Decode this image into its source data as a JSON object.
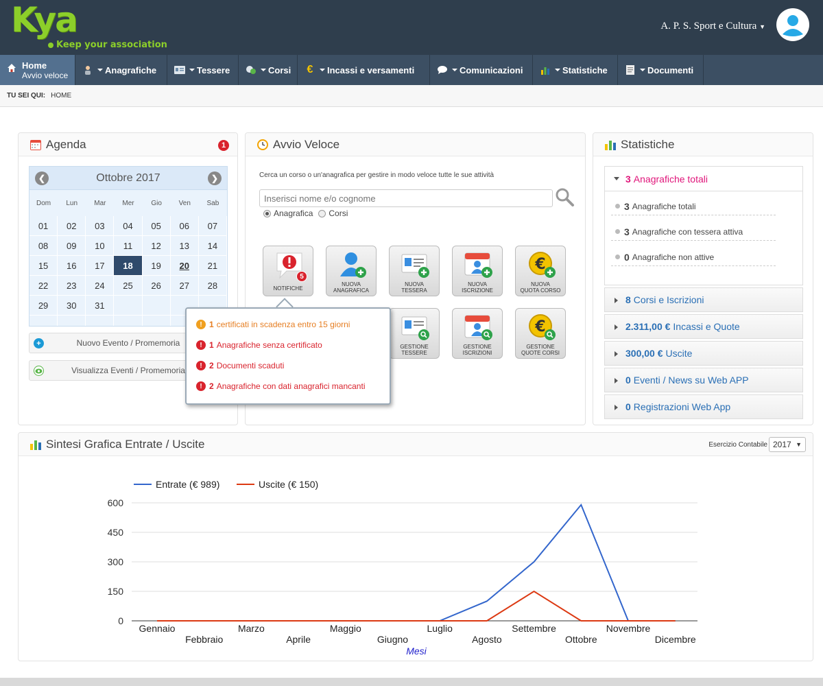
{
  "header": {
    "logo_text": "Kya",
    "logo_tagline": "Keep your association",
    "org_name": "A. P. S. Sport e Cultura",
    "avatar_icon": "user-avatar-icon"
  },
  "menu": {
    "home": {
      "label": "Home",
      "sublabel": "Avvio veloce"
    },
    "items": [
      {
        "label": "Anagrafiche"
      },
      {
        "label": "Tessere"
      },
      {
        "label": "Corsi"
      },
      {
        "label": "Incassi e versamenti"
      },
      {
        "label": "Comunicazioni"
      },
      {
        "label": "Statistiche"
      },
      {
        "label": "Documenti"
      }
    ]
  },
  "breadcrumb": {
    "prefix": "TU SEI QUI:",
    "current": "HOME"
  },
  "agenda": {
    "title": "Agenda",
    "badge": "1",
    "month_label": "Ottobre 2017",
    "weekdays": [
      "Dom",
      "Lun",
      "Mar",
      "Mer",
      "Gio",
      "Ven",
      "Sab"
    ],
    "weeks": [
      [
        "01",
        "02",
        "03",
        "04",
        "05",
        "06",
        "07"
      ],
      [
        "08",
        "09",
        "10",
        "11",
        "12",
        "13",
        "14"
      ],
      [
        "15",
        "16",
        "17",
        "18",
        "19",
        "20",
        "21"
      ],
      [
        "22",
        "23",
        "24",
        "25",
        "26",
        "27",
        "28"
      ],
      [
        "29",
        "30",
        "31",
        "",
        "",
        "",
        ""
      ],
      [
        "",
        "",
        "",
        "",
        "",
        "",
        ""
      ]
    ],
    "today": "18",
    "marked": "20",
    "new_event_label": "Nuovo Evento / Promemoria",
    "view_events_label": "Visualizza Eventi / Promemoria"
  },
  "avvio": {
    "title": "Avvio Veloce",
    "description": "Cerca un corso o un'anagrafica per gestire in modo veloce tutte le sue attività",
    "search_placeholder": "Inserisci nome e/o cognome",
    "radio_anagrafica": "Anagrafica",
    "radio_corsi": "Corsi",
    "tiles_row1": [
      {
        "line1": "NOTIFICHE",
        "line2": ""
      },
      {
        "line1": "NUOVA",
        "line2": "ANAGRAFICA"
      },
      {
        "line1": "NUOVA",
        "line2": "TESSERA"
      },
      {
        "line1": "NUOVA",
        "line2": "ISCRIZIONE"
      },
      {
        "line1": "NUOVA",
        "line2": "QUOTA CORSO"
      }
    ],
    "tiles_row2": [
      {
        "line1": "GESTIONE",
        "line2": "TESSERE"
      },
      {
        "line1": "GESTIONE",
        "line2": "ISCRIZIONI"
      },
      {
        "line1": "GESTIONE",
        "line2": "QUOTE CORSI"
      }
    ],
    "notifications_count": "5",
    "popup": [
      {
        "count": "1",
        "text": "certificati in scadenza entro 15 giorni",
        "level": "warning"
      },
      {
        "count": "1",
        "text": "Anagrafiche senza certificato",
        "level": "error"
      },
      {
        "count": "2",
        "text": "Documenti scaduti",
        "level": "error"
      },
      {
        "count": "2",
        "text": "Anagrafiche con dati anagrafici mancanti",
        "level": "error"
      }
    ]
  },
  "stats": {
    "title": "Statistiche",
    "expanded": {
      "count": "3",
      "label": "Anagrafiche totali"
    },
    "sub": [
      {
        "count": "3",
        "label": "Anagrafiche totali"
      },
      {
        "count": "3",
        "label": "Anagrafiche con tessera attiva"
      },
      {
        "count": "0",
        "label": "Anagrafiche non attive"
      }
    ],
    "rows": [
      {
        "count": "8",
        "label": "Corsi e Iscrizioni"
      },
      {
        "count": "2.311,00 €",
        "label": "Incassi e Quote"
      },
      {
        "count": "300,00 €",
        "label": "Uscite"
      },
      {
        "count": "0",
        "label": "Eventi / News su Web APP"
      },
      {
        "count": "0",
        "label": "Registrazioni Web App"
      }
    ]
  },
  "chart_panel": {
    "title": "Sintesi Grafica Entrate / Uscite",
    "select_label": "Esercizio Contabile",
    "select_value": "2017"
  },
  "chart_data": {
    "type": "line",
    "title": "",
    "xlabel": "Mesi",
    "ylabel": "",
    "categories": [
      "Gennaio",
      "Febbraio",
      "Marzo",
      "Aprile",
      "Maggio",
      "Giugno",
      "Luglio",
      "Agosto",
      "Settembre",
      "Ottobre",
      "Novembre",
      "Dicembre"
    ],
    "ylim": [
      0,
      600
    ],
    "yticks": [
      "0",
      "150",
      "300",
      "450",
      "600"
    ],
    "grid": true,
    "legend": "top-left",
    "series": [
      {
        "name": "Entrate (€ 989)",
        "color": "#3366cc",
        "values": [
          0,
          0,
          0,
          0,
          0,
          0,
          0,
          100,
          300,
          590,
          0,
          0
        ]
      },
      {
        "name": "Uscite (€ 150)",
        "color": "#dc3912",
        "values": [
          0,
          0,
          0,
          0,
          0,
          0,
          0,
          0,
          150,
          0,
          0,
          0
        ]
      }
    ]
  }
}
